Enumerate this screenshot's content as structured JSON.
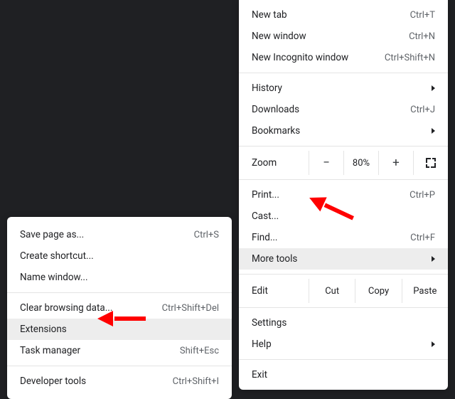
{
  "mainMenu": {
    "newTab": {
      "label": "New tab",
      "shortcut": "Ctrl+T"
    },
    "newWindow": {
      "label": "New window",
      "shortcut": "Ctrl+N"
    },
    "newIncognito": {
      "label": "New Incognito window",
      "shortcut": "Ctrl+Shift+N"
    },
    "history": {
      "label": "History"
    },
    "downloads": {
      "label": "Downloads",
      "shortcut": "Ctrl+J"
    },
    "bookmarks": {
      "label": "Bookmarks"
    },
    "zoom": {
      "label": "Zoom",
      "value": "80%"
    },
    "print": {
      "label": "Print...",
      "shortcut": "Ctrl+P"
    },
    "cast": {
      "label": "Cast..."
    },
    "find": {
      "label": "Find...",
      "shortcut": "Ctrl+F"
    },
    "moreTools": {
      "label": "More tools"
    },
    "edit": {
      "label": "Edit",
      "cut": "Cut",
      "copy": "Copy",
      "paste": "Paste"
    },
    "settings": {
      "label": "Settings"
    },
    "help": {
      "label": "Help"
    },
    "exit": {
      "label": "Exit"
    }
  },
  "subMenu": {
    "savePage": {
      "label": "Save page as...",
      "shortcut": "Ctrl+S"
    },
    "createShortcut": {
      "label": "Create shortcut..."
    },
    "nameWindow": {
      "label": "Name window..."
    },
    "clearBrowsing": {
      "label": "Clear browsing data...",
      "shortcut": "Ctrl+Shift+Del"
    },
    "extensions": {
      "label": "Extensions"
    },
    "taskManager": {
      "label": "Task manager",
      "shortcut": "Shift+Esc"
    },
    "devTools": {
      "label": "Developer tools",
      "shortcut": "Ctrl+Shift+I"
    }
  }
}
